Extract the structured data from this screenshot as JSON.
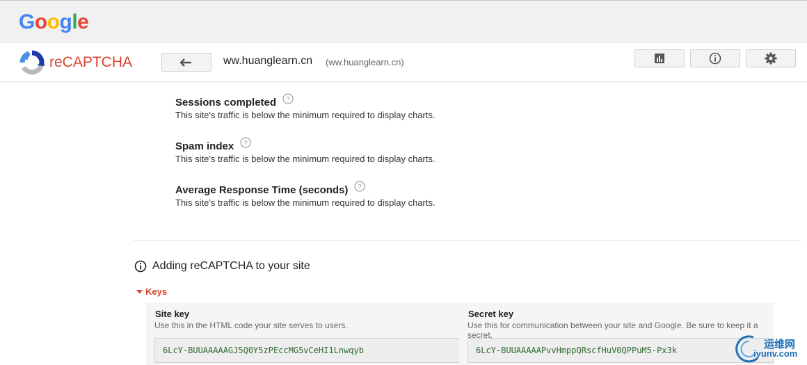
{
  "google": {
    "logo_letters": [
      "G",
      "o",
      "o",
      "g",
      "l",
      "e"
    ],
    "logo_colors": [
      "#4285f4",
      "#ea4335",
      "#fbbc05",
      "#4285f4",
      "#34a853",
      "#ea4335"
    ]
  },
  "app": {
    "name": "reCAPTCHA",
    "accent": "#d9432f"
  },
  "header": {
    "site_label": "ww.huanglearn.cn",
    "site_domain": "(ww.huanglearn.cn)"
  },
  "toolbar": {
    "back_icon": "arrow-left-icon",
    "analytics_icon": "bar-chart-icon",
    "info_icon": "info-icon",
    "settings_icon": "gear-icon"
  },
  "metrics": [
    {
      "title": "Sessions completed",
      "message": "This site's traffic is below the minimum required to display charts."
    },
    {
      "title": "Spam index",
      "message": "This site's traffic is below the minimum required to display charts."
    },
    {
      "title": "Average Response Time (seconds)",
      "message": "This site's traffic is below the minimum required to display charts."
    }
  ],
  "adding": {
    "title": "Adding reCAPTCHA to your site"
  },
  "keys": {
    "toggle_label": "Keys",
    "site_key": {
      "label": "Site key",
      "description": "Use this in the HTML code your site serves to users.",
      "value": "6LcY-BUUAAAAAGJ5Q0Y5zPEccMG5vCeHI1Lnwqyb"
    },
    "secret_key": {
      "label": "Secret key",
      "description": "Use this for communication between your site and Google. Be sure to keep it a secret.",
      "value": "6LcY-BUUAAAAAPvvHmppQRscfHuV0QPPuM5-Px3k"
    }
  },
  "watermark": {
    "cn": "运维网",
    "en": "iyunv.com"
  }
}
